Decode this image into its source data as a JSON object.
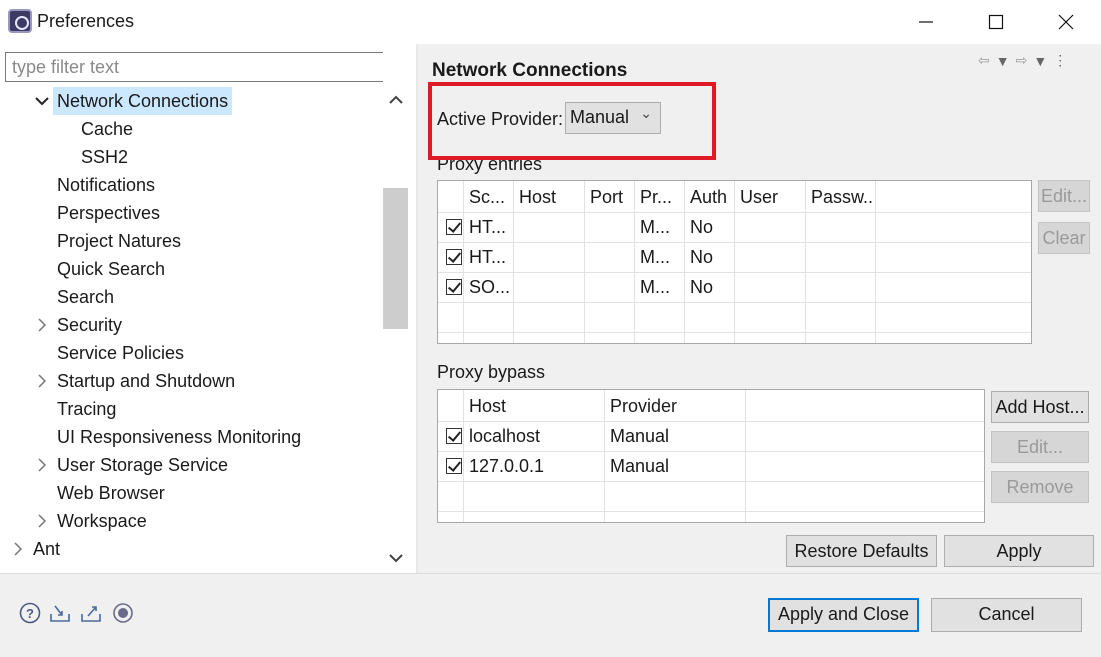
{
  "window": {
    "title": "Preferences",
    "icons": [
      "app-icon",
      "minimize-icon",
      "maximize-icon",
      "close-icon"
    ]
  },
  "left": {
    "filter_placeholder": "type filter text",
    "tree": [
      {
        "label": "Network Connections",
        "expanded": true,
        "selected": true
      },
      {
        "label": "Cache"
      },
      {
        "label": "SSH2"
      },
      {
        "label": "Notifications"
      },
      {
        "label": "Perspectives"
      },
      {
        "label": "Project Natures"
      },
      {
        "label": "Quick Search"
      },
      {
        "label": "Search"
      },
      {
        "label": "Security",
        "collapsed": true
      },
      {
        "label": "Service Policies"
      },
      {
        "label": "Startup and Shutdown",
        "collapsed": true
      },
      {
        "label": "Tracing"
      },
      {
        "label": "UI Responsiveness Monitoring"
      },
      {
        "label": "User Storage Service",
        "collapsed": true
      },
      {
        "label": "Web Browser"
      },
      {
        "label": "Workspace",
        "collapsed": true
      },
      {
        "label": "Ant",
        "collapsed": true
      }
    ]
  },
  "main": {
    "title": "Network Connections",
    "nav_icons": [
      "back-arrow-icon",
      "dropdown-icon",
      "forward-arrow-icon",
      "dropdown-icon",
      "view-menu-icon"
    ],
    "active_provider_label": "Active Provider:",
    "active_provider_value": "Manual",
    "proxy_entries": {
      "label": "Proxy entries",
      "headers": [
        "Sc...",
        "Host",
        "Port",
        "Pr...",
        "Auth",
        "User",
        "Passw..."
      ],
      "rows": [
        {
          "checked": true,
          "scheme": "HT...",
          "host": "",
          "port": "",
          "provider": "M...",
          "auth": "No",
          "user": "",
          "password": ""
        },
        {
          "checked": true,
          "scheme": "HT...",
          "host": "",
          "port": "",
          "provider": "M...",
          "auth": "No",
          "user": "",
          "password": ""
        },
        {
          "checked": true,
          "scheme": "SO...",
          "host": "",
          "port": "",
          "provider": "M...",
          "auth": "No",
          "user": "",
          "password": ""
        }
      ],
      "edit_label": "Edit...",
      "clear_label": "Clear"
    },
    "proxy_bypass": {
      "label": "Proxy bypass",
      "headers": [
        "Host",
        "Provider"
      ],
      "rows": [
        {
          "checked": true,
          "host": "localhost",
          "provider": "Manual"
        },
        {
          "checked": true,
          "host": "127.0.0.1",
          "provider": "Manual"
        }
      ],
      "add_host_label": "Add Host...",
      "edit_label": "Edit...",
      "remove_label": "Remove"
    },
    "restore_defaults_label": "Restore Defaults",
    "apply_label": "Apply"
  },
  "bottom": {
    "icons": [
      "help-icon",
      "import-icon",
      "export-icon",
      "record-icon"
    ],
    "apply_close_label": "Apply and Close",
    "cancel_label": "Cancel"
  },
  "colors": {
    "highlight": "#e01a24",
    "selection": "#cce8ff",
    "focus": "#0078d7"
  }
}
